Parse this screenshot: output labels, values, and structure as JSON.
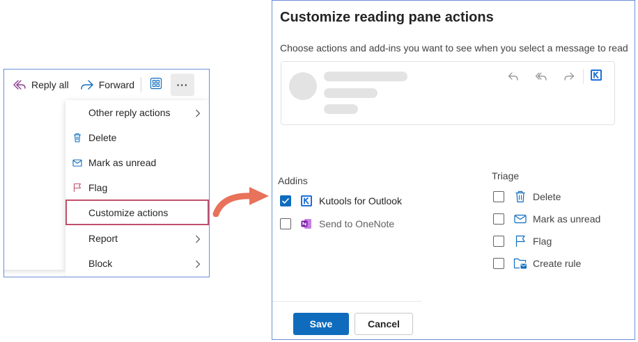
{
  "toolbar": {
    "reply_all_label": "Reply all",
    "forward_label": "Forward",
    "more_label": "···"
  },
  "menu": {
    "items": [
      {
        "label": "Other reply actions",
        "icon": "none",
        "submenu": true
      },
      {
        "label": "Delete",
        "icon": "trash-icon",
        "submenu": false
      },
      {
        "label": "Mark as unread",
        "icon": "envelope-icon",
        "submenu": false
      },
      {
        "label": "Flag",
        "icon": "flag-icon",
        "submenu": false
      },
      {
        "label": "Customize actions",
        "icon": "none",
        "submenu": false,
        "highlighted": true
      },
      {
        "label": "Report",
        "icon": "none",
        "submenu": true
      },
      {
        "label": "Block",
        "icon": "none",
        "submenu": true
      }
    ]
  },
  "dialog": {
    "title": "Customize reading pane actions",
    "description": "Choose actions and add-ins you want to see when you select a message to read",
    "addins": {
      "heading": "Addins",
      "items": [
        {
          "label": "Kutools for Outlook",
          "checked": true,
          "icon": "kutools-icon"
        },
        {
          "label": "Send to OneNote",
          "checked": false,
          "icon": "onenote-icon"
        }
      ]
    },
    "triage": {
      "heading": "Triage",
      "items": [
        {
          "label": "Delete",
          "checked": false,
          "icon": "trash-icon"
        },
        {
          "label": "Mark as unread",
          "checked": false,
          "icon": "envelope-icon"
        },
        {
          "label": "Flag",
          "checked": false,
          "icon": "flag-icon"
        },
        {
          "label": "Create rule",
          "checked": false,
          "icon": "folder-rule-icon"
        }
      ]
    },
    "save_label": "Save",
    "cancel_label": "Cancel"
  },
  "colors": {
    "accent": "#0f6cbd",
    "highlight_border": "#c0506a",
    "arrow": "#e8725a",
    "frame_border": "#6b8fd6"
  }
}
